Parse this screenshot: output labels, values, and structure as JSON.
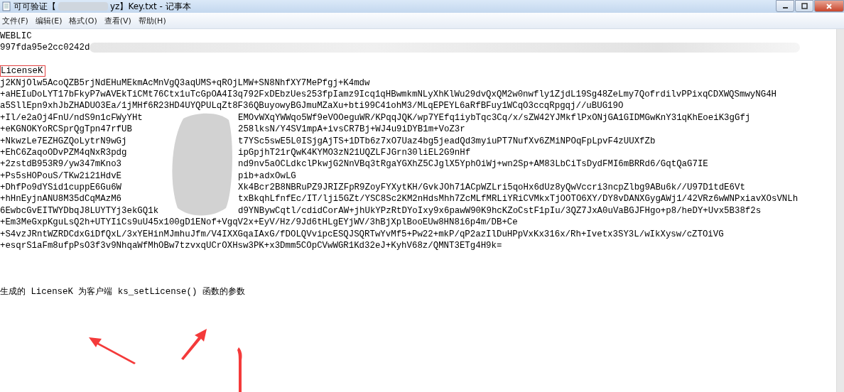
{
  "window": {
    "title_before": "可可验证【",
    "title_after": "yz】Key.txt - 记事本"
  },
  "menu": [
    {
      "label": "文件(F)"
    },
    {
      "label": "编辑(E)"
    },
    {
      "label": "格式(O)"
    },
    {
      "label": "查看(V)"
    },
    {
      "label": "帮助(H)"
    }
  ],
  "header_lines": [
    {
      "kind": "text",
      "text": "WEBLIC"
    },
    {
      "kind": "blurred",
      "left": "997fda95e2cc0242d"
    }
  ],
  "license_label": "LicenseK",
  "key_lines": [
    {
      "kind": "text",
      "text": "j2KNjOlw5AcoQZB5rjNdEHuMEkmAcMnVgQ3aqUMS+qROjLMW+SN8NhfXY7MePfgj+K4mdw"
    },
    {
      "kind": "text",
      "text": "+aHEIuDoLYT17bFkyP7wAVEkTiCMt76Ctx1uTcGpOA4I3q792FxDEbzUes253fpIamz9Icq1qHBwmkmNLyXhKlWu29dvQxQM2w0nwfly1ZjdL19Sg48ZeLmy7QofrdilvPPixqCDXWQSmwyNG4H"
    },
    {
      "kind": "text",
      "text": "a5SllEpn9xhJbZHADUO3Ea/1jMHf6R23HD4UYQPULqZt8F36QBuyowyBGJmuMZaXu+bti99C41ohM3/MLqEPEYL6aRfBFuy1WCqO3ccqRpgqj//uBUG19O"
    },
    {
      "kind": "blurred",
      "left": "+Il/e2aOj4FnU/ndS9n1cFWyYHt",
      "right": "EMOvWXqYWWqo5Wf9eVOOeguWR/KPqqJQK/wp7YEfq1iybTqc3Cq/x/sZW42YJMkflPxONjGA1GIDMGwKnY31qKhEoeiK3gGfj"
    },
    {
      "kind": "blurred",
      "left": "+eKGNOKYoRCSprQgTpn47rfUB",
      "right": "258lksN/Y4SV1mpA+ivsCR7Bj+WJ4u9iDYB1m+VoZ3r"
    },
    {
      "kind": "blurred",
      "left": "+NkwzLe7EZHGZQoLytrN9wGj",
      "right": "t7YSc5swE5L0ISjgAjTS+1DTb6z7xO7Uaz4bg5jeadQd3myiuPT7NufXv6ZMiNPOqFpLpvF4zUUXfZb"
    },
    {
      "kind": "blurred",
      "left": "+EhC6ZaqoODvPZM4qNxR3pdg",
      "right": "ipGpjhT21rQwK4KYMO3zN21UQZLFJGrn30liEL2G9nHf"
    },
    {
      "kind": "blurred",
      "left": "+2zstdB953R9/yw347mKno3",
      "right": "nd9nv5aOCLdkclPkwjG2NnVBq3tRgaYGXhZ5CJglX5YphOiWj+wn2Sp+AM83LbCiTsDydFMI6mBRRd6/GqtQaG7IE"
    },
    {
      "kind": "blurred",
      "left": "+Ps5sHOPouS/TKw2i21HdvE",
      "right": "pib+adxOwLG"
    },
    {
      "kind": "blurred",
      "left": "+DhfPo9dYSid1cuppE6Gu6W",
      "right": "Xk4Bcr2B8NBRuPZ9JRIZFpR9ZoyFYXytKH/GvkJOh71ACpWZLri5qoHx6dUz8yQwVccri3ncpZlbg9ABu6k//U97D1tdE6Vt"
    },
    {
      "kind": "blurred",
      "left": "+hHnEyjnANU8M35dCqMAzM6",
      "right": "txBkqhLfnfEc/IT/lji5GZt/YSC8Sc2KM2nHdsMhh7ZcMLfMRLiYRiCVMkxTjOOTO6XY/DY8vDANXGygAWj1/42VRz6wWNPxiavXOsVNLh"
    },
    {
      "kind": "blurred",
      "left": "6EwbcGvEITWYDbqJ8LUYTYj3ekGQ1k",
      "right": "d9YNBywCqtl/cdidCorAW+jhUkYPzRtDYoIxy9x6pawW90K9hcKZoCstF1pIu/3QZ7JxA0uVaBGJFHgo+p8/heDY+Uvx5B38f2s"
    },
    {
      "kind": "text",
      "text": "+Em3MeGxpKguLsQ2h+UTYIiCs9uU45x100gD1ENof+VgqV2x+EyV/Hz/9Jd6tHLgEYjWV/3hBjXplBooEUw8HN8i6p4m/DB+Ce"
    },
    {
      "kind": "text",
      "text": "+S4vzJRntWZRDCdxGiDfQxL/3xYEHinMJmhuJfm/V4IXXGqaIAxG/fDOLQVvipcESQJSQRTwYvMf5+Pw22+mkP/qP2azIlDuHPpVxKx316x/Rh+Ivetx3SY3L/wIkXysw/cZTOiVG"
    },
    {
      "kind": "text",
      "text": "+esqrS1aFm8ufpPsO3f3v9NhqaWfMhOBw7tzvxqUCrOXHsw3PK+x3Dmm5COpCVwWGR1Kd32eJ+KyhV68z/QMNT3ETg4H9k="
    }
  ],
  "note": "生成的 LicenseK 为客户端 ks_setLicense() 函数的参数"
}
